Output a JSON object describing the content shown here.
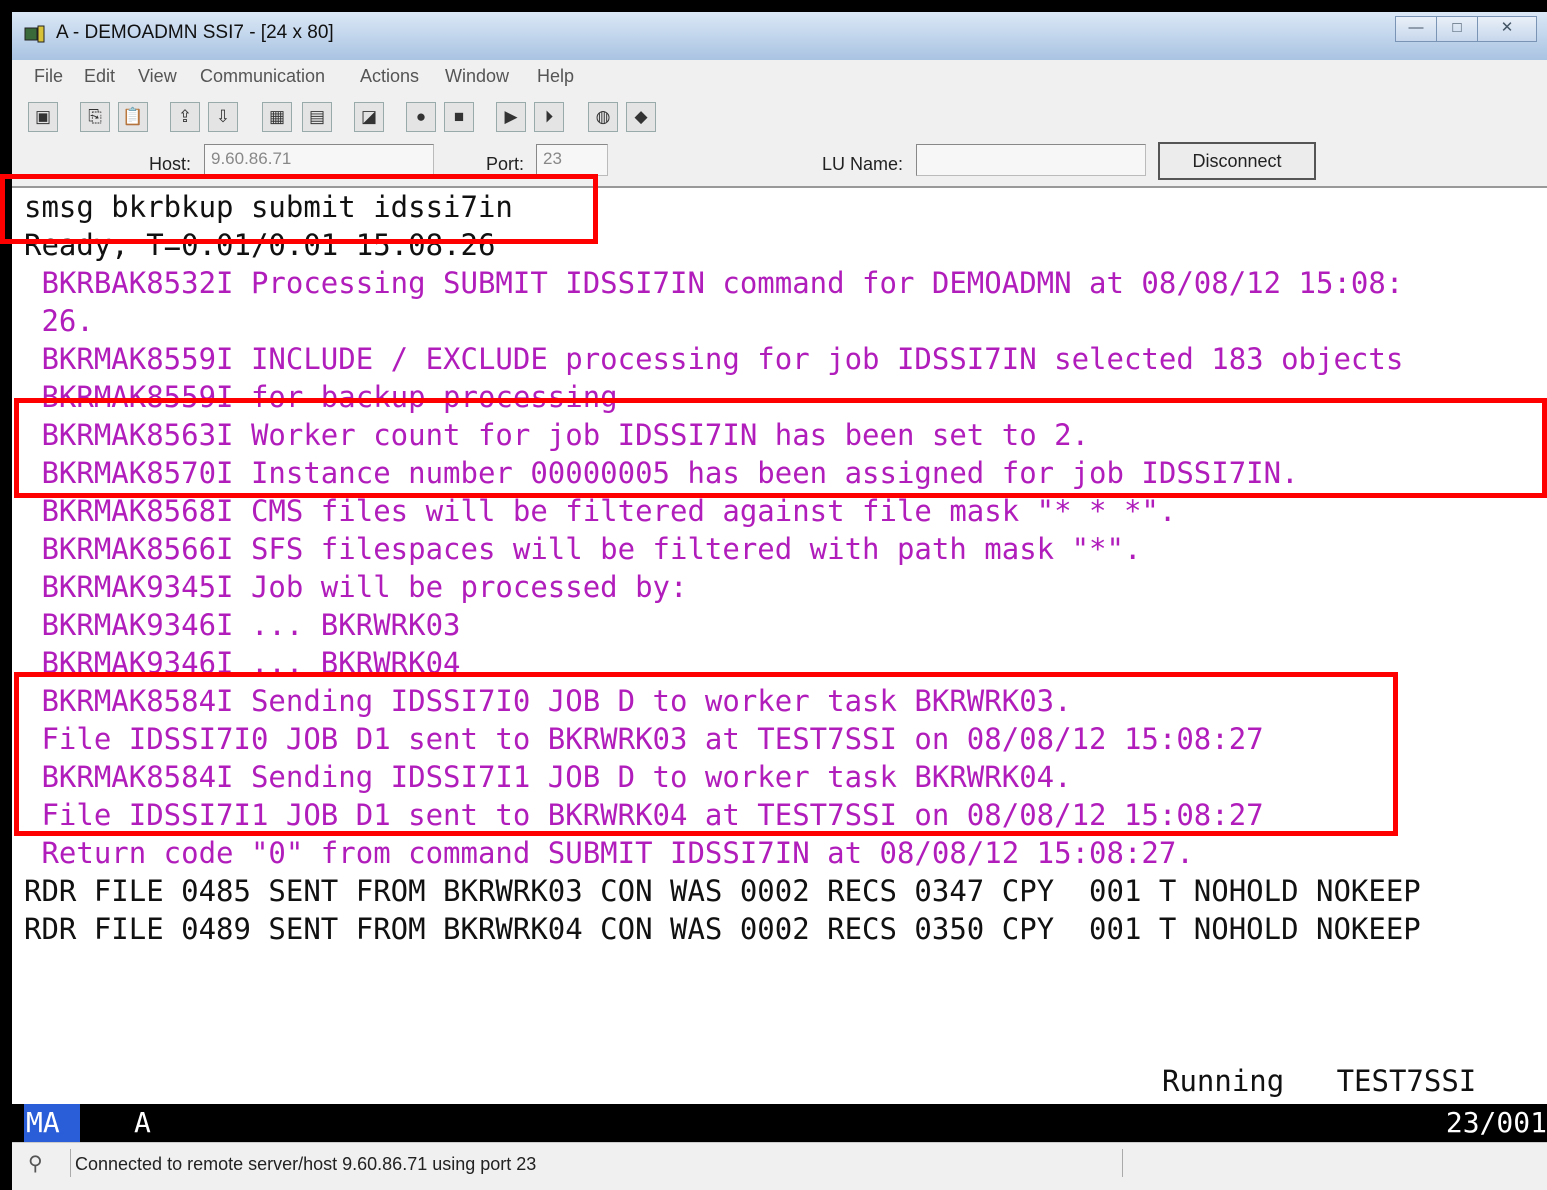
{
  "window": {
    "title": "A - DEMOADMN SSI7 - [24 x 80]",
    "minimize": "—",
    "maximize": "□",
    "close": "✕"
  },
  "menu": [
    "File",
    "Edit",
    "View",
    "Communication",
    "Actions",
    "Window",
    "Help"
  ],
  "toolbar_icons": [
    "print-screen-icon",
    "copy-icon",
    "paste-icon",
    "send-file-icon",
    "receive-file-icon",
    "keypad-icon",
    "macro-icon",
    "record-icon",
    "start-record-icon",
    "stop-record-icon",
    "play-icon",
    "playback-icon",
    "globe-icon",
    "tag-icon"
  ],
  "connection": {
    "host_label": "Host:",
    "host_value": "9.60.86.71",
    "port_label": "Port:",
    "port_value": "23",
    "lu_label": "LU Name:",
    "lu_value": "",
    "disconnect": "Disconnect"
  },
  "terminal": {
    "lines": [
      {
        "text": "smsg bkrbkup submit idssi7in",
        "color": "black"
      },
      {
        "text": "Ready; T=0.01/0.01 15:08:26",
        "color": "black"
      },
      {
        "text": " BKRBAK8532I Processing SUBMIT IDSSI7IN command for DEMOADMN at 08/08/12 15:08:",
        "color": "magenta"
      },
      {
        "text": " 26.",
        "color": "magenta"
      },
      {
        "text": " BKRMAK8559I INCLUDE / EXCLUDE processing for job IDSSI7IN selected 183 objects",
        "color": "magenta"
      },
      {
        "text": " BKRMAK8559I for backup processing",
        "color": "magenta"
      },
      {
        "text": " BKRMAK8563I Worker count for job IDSSI7IN has been set to 2.",
        "color": "magenta"
      },
      {
        "text": " BKRMAK8570I Instance number 00000005 has been assigned for job IDSSI7IN.",
        "color": "magenta"
      },
      {
        "text": " BKRMAK8568I CMS files will be filtered against file mask \"* * *\".",
        "color": "magenta"
      },
      {
        "text": " BKRMAK8566I SFS filespaces will be filtered with path mask \"*\".",
        "color": "magenta"
      },
      {
        "text": " BKRMAK9345I Job will be processed by:",
        "color": "magenta"
      },
      {
        "text": " BKRMAK9346I ... BKRWRK03",
        "color": "magenta"
      },
      {
        "text": " BKRMAK9346I ... BKRWRK04",
        "color": "magenta"
      },
      {
        "text": " BKRMAK8584I Sending IDSSI7I0 JOB D to worker task BKRWRK03.",
        "color": "magenta"
      },
      {
        "text": " File IDSSI7I0 JOB D1 sent to BKRWRK03 at TEST7SSI on 08/08/12 15:08:27",
        "color": "magenta"
      },
      {
        "text": " BKRMAK8584I Sending IDSSI7I1 JOB D to worker task BKRWRK04.",
        "color": "magenta"
      },
      {
        "text": " File IDSSI7I1 JOB D1 sent to BKRWRK04 at TEST7SSI on 08/08/12 15:08:27",
        "color": "magenta"
      },
      {
        "text": " Return code \"0\" from command SUBMIT IDSSI7IN at 08/08/12 15:08:27.",
        "color": "magenta"
      },
      {
        "text": "RDR FILE 0485 SENT FROM BKRWRK03 CON WAS 0002 RECS 0347 CPY  001 T NOHOLD NOKEEP",
        "color": "black"
      },
      {
        "text": "RDR FILE 0489 SENT FROM BKRWRK04 CON WAS 0002 RECS 0350 CPY  001 T NOHOLD NOKEEP",
        "color": "black"
      }
    ],
    "status_right": "Running   TEST7SSI"
  },
  "oia": {
    "ma": "MA",
    "session": "A",
    "cursor": "23/001"
  },
  "statusbar": {
    "message": "Connected to remote server/host 9.60.86.71 using port 23"
  },
  "colors": {
    "magenta": "#b01dbb",
    "highlight": "#ff0000",
    "oia_ma": "#2a5ed8"
  }
}
